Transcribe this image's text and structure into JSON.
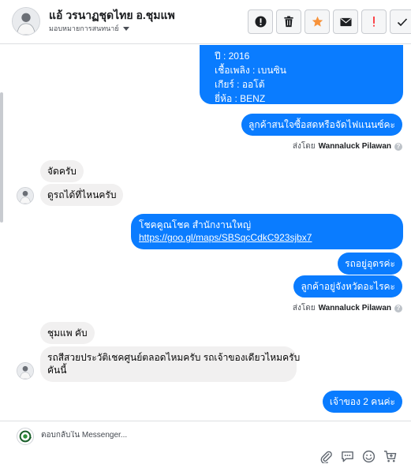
{
  "header": {
    "contact_name": "แอ้ วรนาฏชุดไทย อ.ชุมแพ",
    "assignee": "มอบหมายการสนทนาย์",
    "actions": [
      "mark-important",
      "delete",
      "star",
      "email",
      "report",
      "done"
    ]
  },
  "thread": {
    "car_info": {
      "year": "ปี : 2016",
      "fuel": "เชื้อเพลิง : เบนซิน",
      "gear": "เกียร์ : ออโต้",
      "brand": "ยี่ห้อ : BENZ"
    },
    "msg_interest": "ลูกค้าสนใจซื้อสดหรือจัดไฟแนนซ์คะ",
    "sent_by_1": {
      "prefix": "ส่งโดย",
      "name": "Wannaluck Pilawan",
      "help": "?"
    },
    "msg_in_1": "จัดครับ",
    "msg_in_2": "ดูรถได้ที่ไหนครับ",
    "msg_location_title": "โชคคูณโชค สำนักงานใหญ่",
    "msg_location_link": "https://goo.gl/maps/SBSqcCdkC923sjbx7",
    "msg_out_3": "รถอยู่อุดรค่ะ",
    "msg_out_4": "ลูกค้าอยู่จังหวัดอะไรคะ",
    "sent_by_2": {
      "prefix": "ส่งโดย",
      "name": "Wannaluck Pilawan",
      "help": "?"
    },
    "msg_in_3": "ชุมแพ คับ",
    "msg_in_4_line1": "รถสีสวยประวัติเชคศูนย์ตลอดไหมครับ รถเจ้าของเดียวไหมครับ",
    "msg_in_4_line2": "คันนี้",
    "msg_out_5": "เจ้าของ 2 คนค่ะ"
  },
  "composer": {
    "placeholder": "ตอบกลับใน Messenger...",
    "tools": [
      "attach-icon",
      "saved-replies-icon",
      "emoji-icon",
      "cart-icon"
    ]
  },
  "colors": {
    "outgoing_bubble": "#0a7cff",
    "incoming_bubble": "#f1f0f0",
    "star": "#f7923a",
    "report": "#fa383e"
  }
}
